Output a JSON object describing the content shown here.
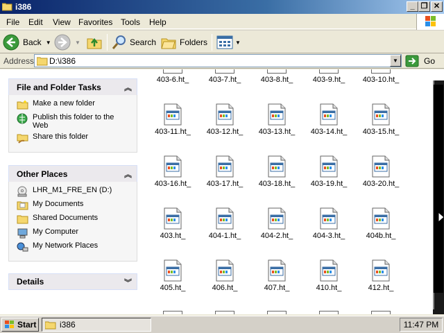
{
  "window": {
    "title": "i386",
    "minimize_label": "_",
    "restore_label": "❐",
    "close_label": "✕"
  },
  "menu": [
    "File",
    "Edit",
    "View",
    "Favorites",
    "Tools",
    "Help"
  ],
  "toolbar": {
    "back_label": "Back",
    "search_label": "Search",
    "folders_label": "Folders"
  },
  "address": {
    "label": "Address",
    "value": "D:\\i386",
    "go_label": "Go"
  },
  "tasks_panel": {
    "title": "File and Folder Tasks",
    "items": [
      {
        "label": "Make a new folder",
        "icon": "new-folder-icon"
      },
      {
        "label": "Publish this folder to the Web",
        "icon": "publish-web-icon"
      },
      {
        "label": "Share this folder",
        "icon": "share-folder-icon"
      }
    ]
  },
  "places_panel": {
    "title": "Other Places",
    "items": [
      {
        "label": "LHR_M1_FRE_EN (D:)",
        "icon": "cd-drive-icon"
      },
      {
        "label": "My Documents",
        "icon": "documents-folder-icon"
      },
      {
        "label": "Shared Documents",
        "icon": "shared-folder-icon"
      },
      {
        "label": "My Computer",
        "icon": "computer-icon"
      },
      {
        "label": "My Network Places",
        "icon": "network-icon"
      }
    ]
  },
  "details_panel": {
    "title": "Details"
  },
  "files": {
    "partial_row": [
      "403-6.ht_",
      "403-7.ht_",
      "403-8.ht_",
      "403-9.ht_",
      "403-10.ht_"
    ],
    "rows": [
      [
        "403-11.ht_",
        "403-12.ht_",
        "403-13.ht_",
        "403-14.ht_",
        "403-15.ht_"
      ],
      [
        "403-16.ht_",
        "403-17.ht_",
        "403-18.ht_",
        "403-19.ht_",
        "403-20.ht_"
      ],
      [
        "403.ht_",
        "404-1.ht_",
        "404-2.ht_",
        "404-3.ht_",
        "404b.ht_"
      ],
      [
        "405.ht_",
        "406.ht_",
        "407.ht_",
        "410.ht_",
        "412.ht_"
      ]
    ]
  },
  "taskbar": {
    "start_label": "Start",
    "task_label": "i386",
    "clock": "11:47 PM"
  },
  "colors": {
    "titlebar_start": "#0a246a",
    "titlebar_end": "#a6caf0",
    "chrome": "#ece9d8",
    "go_green": "#3c9a3c"
  }
}
